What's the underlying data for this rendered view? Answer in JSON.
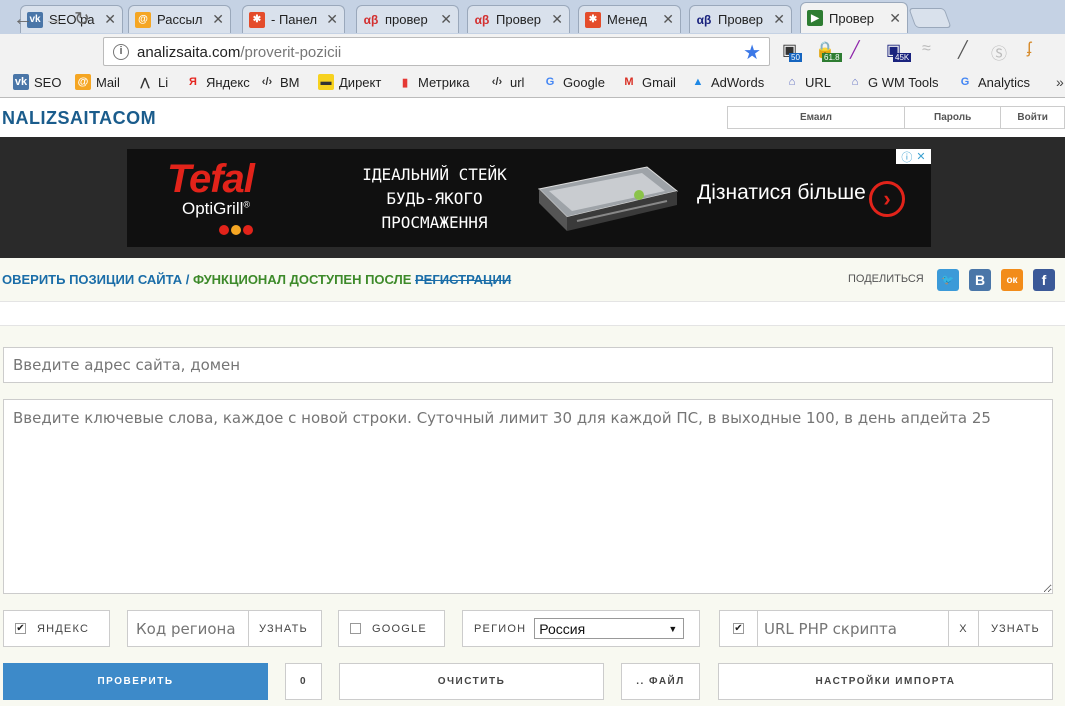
{
  "browser": {
    "tabs": [
      {
        "title": "SEO ра",
        "favicon": "vk-icon",
        "color": "#4a76a8",
        "glyph": "vk"
      },
      {
        "title": "Рассыл",
        "favicon": "mail-at-icon",
        "color": "#f5a623",
        "glyph": "@"
      },
      {
        "title": "- Панел",
        "favicon": "joomla-icon",
        "color": "#e44c2b",
        "glyph": "✱"
      },
      {
        "title": "провер",
        "favicon": "alpha-beta-icon",
        "color": "#d32f2f",
        "glyph": "αβ"
      },
      {
        "title": "Провер",
        "favicon": "alpha-beta-icon",
        "color": "#d32f2f",
        "glyph": "αβ"
      },
      {
        "title": "Менед",
        "favicon": "joomla-icon",
        "color": "#e44c2b",
        "glyph": "✱"
      },
      {
        "title": "Провер",
        "favicon": "alpha-beta-icon",
        "color": "#1a237e",
        "glyph": "αβ"
      },
      {
        "title": "Провер",
        "favicon": "play-arrow-icon",
        "color": "#2e7d32",
        "glyph": "▶"
      }
    ],
    "tab_close": "✕",
    "url_host": "analizsaita.com",
    "url_path": "/proverit-pozicii",
    "extensions": [
      {
        "name": "seo-rank-extension-icon",
        "badge": "50",
        "badge_color": "#1565c0"
      },
      {
        "name": "lock-extension-icon",
        "badge": "61.8",
        "badge_color": "#2e7d32"
      },
      {
        "name": "feather-extension-icon",
        "badge": "",
        "badge_color": ""
      },
      {
        "name": "stats-extension-icon",
        "badge": "45K",
        "badge_color": "#1a237e"
      },
      {
        "name": "wifi-extension-icon",
        "badge": "",
        "badge_color": ""
      },
      {
        "name": "eyedropper-extension-icon",
        "badge": "",
        "badge_color": ""
      },
      {
        "name": "skype-extension-icon",
        "badge": "",
        "badge_color": ""
      },
      {
        "name": "tools-extension-icon",
        "badge": "",
        "badge_color": ""
      }
    ],
    "bookmarks": [
      {
        "label": "SEO",
        "icon": "vk-icon"
      },
      {
        "label": "Mail",
        "icon": "mail-at-icon"
      },
      {
        "label": "Li",
        "icon": "liveinternet-icon"
      },
      {
        "label": "Яндекс",
        "icon": "yandex-icon"
      },
      {
        "label": "ВМ",
        "icon": "code-icon"
      },
      {
        "label": "Директ",
        "icon": "direct-icon"
      },
      {
        "label": "Метрика",
        "icon": "metrika-icon"
      },
      {
        "label": "url",
        "icon": "code-icon"
      },
      {
        "label": "Google",
        "icon": "google-icon"
      },
      {
        "label": "Gmail",
        "icon": "gmail-icon"
      },
      {
        "label": "AdWords",
        "icon": "adwords-icon"
      },
      {
        "label": "URL",
        "icon": "url-icon"
      },
      {
        "label": "G WM Tools",
        "icon": "url-icon"
      },
      {
        "label": "Analytics",
        "icon": "google-icon"
      }
    ],
    "bookmarks_more": "»"
  },
  "header": {
    "logo_text": "NALIZSAITACOM",
    "email_label": "Емаил",
    "password_label": "Пароль",
    "login_label": "Войти"
  },
  "ad": {
    "brand": "Tefal",
    "product": "OptiGrill",
    "product_mark": "®",
    "slogan_line1": "ІДЕАЛЬНИЙ СТЕЙК",
    "slogan_line2": "БУДЬ-ЯКОГО",
    "slogan_line3": "ПРОСМАЖЕННЯ",
    "cta": "Дізнатися більше",
    "info_icon": "ⓘ",
    "close_icon": "✕"
  },
  "title": {
    "part1": "ОВЕРИТЬ ПОЗИЦИИ САЙТА / ",
    "part2": "ФУНКЦИОНАЛ ДОСТУПЕН ПОСЛЕ ",
    "link": "РЕГИСТРАЦИИ",
    "share_label": "ПОДЕЛИТЬСЯ",
    "social": [
      {
        "name": "twitter-icon",
        "glyph": "🐦",
        "color": "#3b9ad8"
      },
      {
        "name": "vk-icon",
        "glyph": "В",
        "color": "#4a76a8"
      },
      {
        "name": "odnoklassniki-icon",
        "glyph": "ок",
        "color": "#f28c1a"
      },
      {
        "name": "facebook-icon",
        "glyph": "f",
        "color": "#3b5998"
      }
    ]
  },
  "form": {
    "domain_placeholder": "Введите адрес сайта, домен",
    "keywords_placeholder": "Введите ключевые слова, каждое с новой строки. Суточный лимит 30 для каждой ПС, в выходные 100, в день апдейта 25",
    "yandex_label": "ЯНДЕКС",
    "yandex_checked": true,
    "region_code_placeholder": "Код региона",
    "learn_label": "УЗНАТЬ",
    "google_label": "GOOGLE",
    "google_checked": false,
    "region_label": "РЕГИОН",
    "region_value": "Россия",
    "url_checked": true,
    "url_placeholder": "URL PHP скрипта",
    "clear_x": "X",
    "learn_label2": "УЗНАТЬ"
  },
  "actions": {
    "check": "ПРОВЕРИТЬ",
    "counter": "0",
    "clear": "ОЧИСТИТЬ",
    "file": ".. ФАЙЛ",
    "import_settings": "НАСТРОЙКИ ИМПОРТА"
  }
}
